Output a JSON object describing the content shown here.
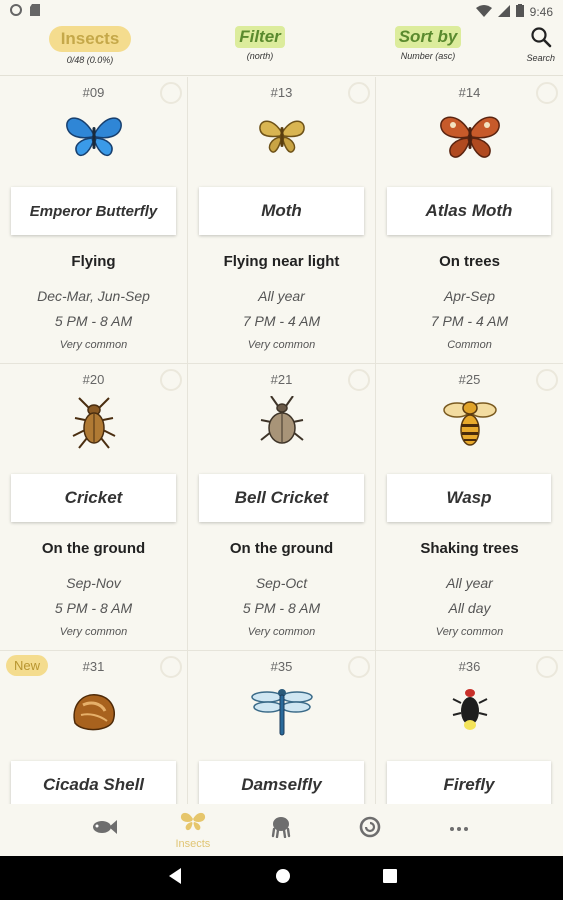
{
  "status_bar": {
    "time": "9:46"
  },
  "header": {
    "category": {
      "label": "Insects",
      "sub": "0/48 (0.0%)"
    },
    "filter": {
      "label": "Filter",
      "sub": "(north)"
    },
    "sort": {
      "label": "Sort by",
      "sub": "Number (asc)"
    },
    "search": {
      "label": "Search"
    }
  },
  "colors": {
    "accent": "#f4dc8e",
    "green_pill": "#dcec9c",
    "background": "#f8f7f0"
  },
  "items": [
    {
      "number": "#09",
      "name": "Emperor Butterfly",
      "location": "Flying",
      "months": "Dec-Mar, Jun-Sep",
      "time": "5 PM - 8 AM",
      "rarity": "Very common",
      "new": "",
      "icon": "emperor-butterfly-icon"
    },
    {
      "number": "#13",
      "name": "Moth",
      "location": "Flying near light",
      "months": "All year",
      "time": "7 PM - 4 AM",
      "rarity": "Very common",
      "new": "",
      "icon": "moth-icon"
    },
    {
      "number": "#14",
      "name": "Atlas Moth",
      "location": "On trees",
      "months": "Apr-Sep",
      "time": "7 PM - 4 AM",
      "rarity": "Common",
      "new": "",
      "icon": "atlas-moth-icon"
    },
    {
      "number": "#20",
      "name": "Cricket",
      "location": "On the ground",
      "months": "Sep-Nov",
      "time": "5 PM - 8 AM",
      "rarity": "Very common",
      "new": "",
      "icon": "cricket-icon"
    },
    {
      "number": "#21",
      "name": "Bell Cricket",
      "location": "On the ground",
      "months": "Sep-Oct",
      "time": "5 PM - 8 AM",
      "rarity": "Very common",
      "new": "",
      "icon": "bell-cricket-icon"
    },
    {
      "number": "#25",
      "name": "Wasp",
      "location": "Shaking trees",
      "months": "All year",
      "time": "All day",
      "rarity": "Very common",
      "new": "",
      "icon": "wasp-icon"
    },
    {
      "number": "#31",
      "name": "Cicada Shell",
      "location": "",
      "months": "",
      "time": "",
      "rarity": "",
      "new": "New",
      "icon": "cicada-shell-icon"
    },
    {
      "number": "#35",
      "name": "Damselfly",
      "location": "",
      "months": "",
      "time": "",
      "rarity": "",
      "new": "",
      "icon": "damselfly-icon"
    },
    {
      "number": "#36",
      "name": "Firefly",
      "location": "",
      "months": "",
      "time": "",
      "rarity": "",
      "new": "",
      "icon": "firefly-icon"
    }
  ],
  "bottom_nav": [
    {
      "label": "",
      "icon": "fish-icon",
      "active": false
    },
    {
      "label": "Insects",
      "icon": "butterfly-icon",
      "active": true
    },
    {
      "label": "",
      "icon": "octopus-icon",
      "active": false
    },
    {
      "label": "",
      "icon": "fossil-icon",
      "active": false
    },
    {
      "label": "",
      "icon": "more-icon",
      "active": false
    }
  ]
}
